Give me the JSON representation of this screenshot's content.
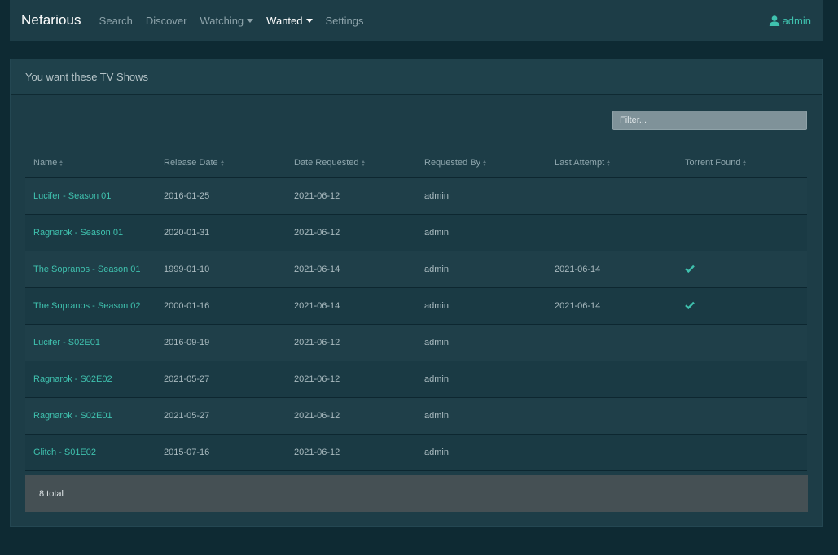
{
  "nav": {
    "brand": "Nefarious",
    "links": [
      {
        "label": "Search"
      },
      {
        "label": "Discover"
      },
      {
        "label": "Watching"
      },
      {
        "label": "Wanted"
      },
      {
        "label": "Settings"
      }
    ],
    "user": "admin",
    "user_icon": "user-icon"
  },
  "card": {
    "header": "You want these TV Shows",
    "filter_placeholder": "Filter..."
  },
  "table": {
    "columns": [
      "Name",
      "Release Date",
      "Date Requested",
      "Requested By",
      "Last Attempt",
      "Torrent Found"
    ],
    "rows": [
      {
        "name": "Lucifer - Season 01",
        "release_date": "2016-01-25",
        "date_requested": "2021-06-12",
        "requested_by": "admin",
        "last_attempt": "",
        "torrent_found": false
      },
      {
        "name": "Ragnarok - Season 01",
        "release_date": "2020-01-31",
        "date_requested": "2021-06-12",
        "requested_by": "admin",
        "last_attempt": "",
        "torrent_found": false
      },
      {
        "name": "The Sopranos - Season 01",
        "release_date": "1999-01-10",
        "date_requested": "2021-06-14",
        "requested_by": "admin",
        "last_attempt": "2021-06-14",
        "torrent_found": true
      },
      {
        "name": "The Sopranos - Season 02",
        "release_date": "2000-01-16",
        "date_requested": "2021-06-14",
        "requested_by": "admin",
        "last_attempt": "2021-06-14",
        "torrent_found": true
      },
      {
        "name": "Lucifer - S02E01",
        "release_date": "2016-09-19",
        "date_requested": "2021-06-12",
        "requested_by": "admin",
        "last_attempt": "",
        "torrent_found": false
      },
      {
        "name": "Ragnarok - S02E02",
        "release_date": "2021-05-27",
        "date_requested": "2021-06-12",
        "requested_by": "admin",
        "last_attempt": "",
        "torrent_found": false
      },
      {
        "name": "Ragnarok - S02E01",
        "release_date": "2021-05-27",
        "date_requested": "2021-06-12",
        "requested_by": "admin",
        "last_attempt": "",
        "torrent_found": false
      },
      {
        "name": "Glitch - S01E02",
        "release_date": "2015-07-16",
        "date_requested": "2021-06-12",
        "requested_by": "admin",
        "last_attempt": "",
        "torrent_found": false
      }
    ],
    "footer_total": "8 total"
  },
  "colors": {
    "accent": "#3fc1ae",
    "background": "#0e2a33",
    "panel": "#1d3d47"
  }
}
